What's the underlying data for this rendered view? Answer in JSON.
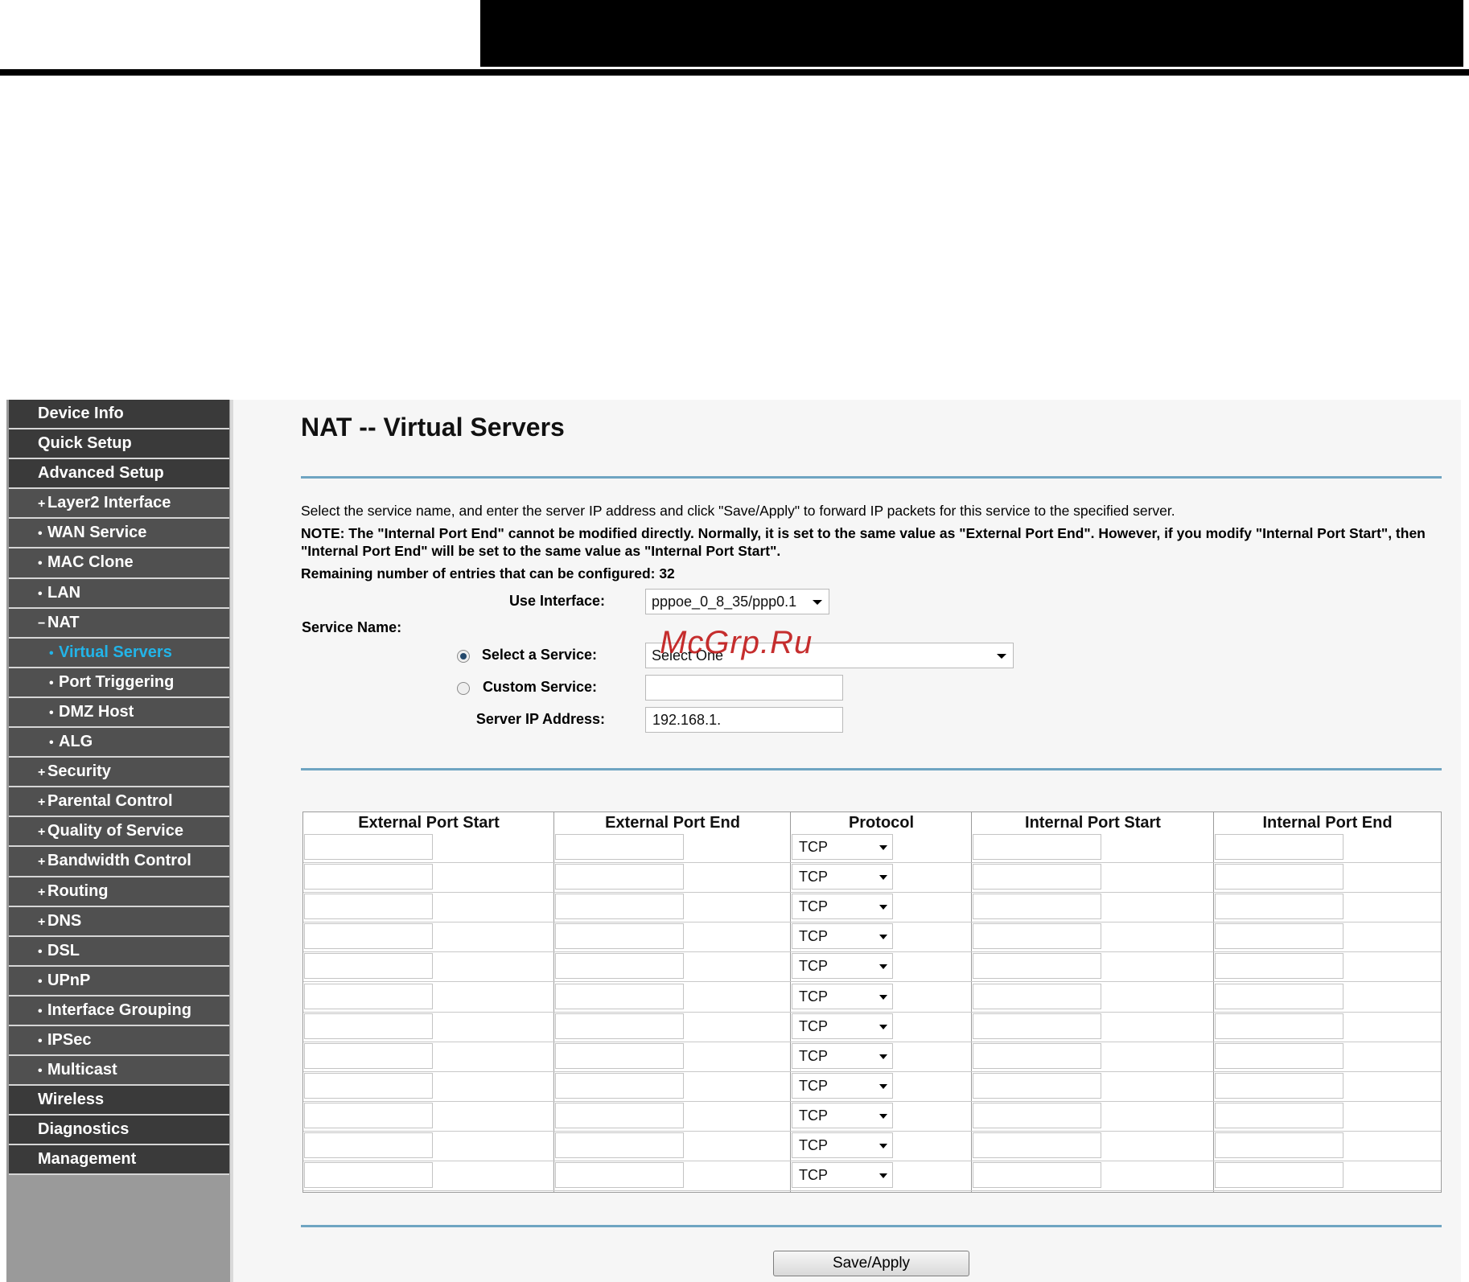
{
  "sidebar": {
    "items": [
      {
        "label": "Device Info",
        "level": "top",
        "marker": ""
      },
      {
        "label": "Quick Setup",
        "level": "top",
        "marker": ""
      },
      {
        "label": "Advanced Setup",
        "level": "top",
        "marker": ""
      },
      {
        "label": "Layer2 Interface",
        "level": "sub",
        "marker": "+"
      },
      {
        "label": "WAN Service",
        "level": "sub",
        "marker": "•"
      },
      {
        "label": "MAC Clone",
        "level": "sub",
        "marker": "•"
      },
      {
        "label": "LAN",
        "level": "sub",
        "marker": "•"
      },
      {
        "label": "NAT",
        "level": "sub",
        "marker": "−"
      },
      {
        "label": "Virtual Servers",
        "level": "subsub",
        "marker": "•",
        "active": true
      },
      {
        "label": "Port Triggering",
        "level": "subsub",
        "marker": "•"
      },
      {
        "label": "DMZ Host",
        "level": "subsub",
        "marker": "•"
      },
      {
        "label": "ALG",
        "level": "subsub",
        "marker": "•"
      },
      {
        "label": "Security",
        "level": "sub",
        "marker": "+"
      },
      {
        "label": "Parental Control",
        "level": "sub",
        "marker": "+"
      },
      {
        "label": "Quality of Service",
        "level": "sub",
        "marker": "+"
      },
      {
        "label": "Bandwidth Control",
        "level": "sub",
        "marker": "+"
      },
      {
        "label": "Routing",
        "level": "sub",
        "marker": "+"
      },
      {
        "label": "DNS",
        "level": "sub",
        "marker": "+"
      },
      {
        "label": "DSL",
        "level": "sub",
        "marker": "•"
      },
      {
        "label": "UPnP",
        "level": "sub",
        "marker": "•"
      },
      {
        "label": "Interface Grouping",
        "level": "sub",
        "marker": "•"
      },
      {
        "label": "IPSec",
        "level": "sub",
        "marker": "•"
      },
      {
        "label": "Multicast",
        "level": "sub",
        "marker": "•"
      },
      {
        "label": "Wireless",
        "level": "top",
        "marker": ""
      },
      {
        "label": "Diagnostics",
        "level": "top",
        "marker": ""
      },
      {
        "label": "Management",
        "level": "top",
        "marker": ""
      }
    ]
  },
  "main": {
    "title": "NAT -- Virtual Servers",
    "intro": "Select the service name, and enter the server IP address and click \"Save/Apply\" to forward IP packets for this service to the specified server.",
    "note_line1": "NOTE: The \"Internal Port End\" cannot be modified directly. Normally, it is set to the same value as \"External Port End\". However, if you modify \"Internal Port Start\", then",
    "note_line2": "\"Internal Port End\" will be set to the same value as \"Internal Port Start\".",
    "remaining": "Remaining number of entries that can be configured: 32"
  },
  "form": {
    "use_interface_label": "Use Interface:",
    "use_interface_value": "pppoe_0_8_35/ppp0.1",
    "service_name_label": "Service Name:",
    "select_service_label": "Select a Service:",
    "select_service_value": "Select One",
    "custom_service_label": "Custom Service:",
    "custom_service_value": "",
    "server_ip_label": "Server IP Address:",
    "server_ip_value": "192.168.1."
  },
  "ports_table": {
    "headers": [
      "External Port Start",
      "External Port End",
      "Protocol",
      "Internal Port Start",
      "Internal Port End"
    ],
    "rows": [
      {
        "protocol": "TCP"
      },
      {
        "protocol": "TCP"
      },
      {
        "protocol": "TCP"
      },
      {
        "protocol": "TCP"
      },
      {
        "protocol": "TCP"
      },
      {
        "protocol": "TCP"
      },
      {
        "protocol": "TCP"
      },
      {
        "protocol": "TCP"
      },
      {
        "protocol": "TCP"
      },
      {
        "protocol": "TCP"
      },
      {
        "protocol": "TCP"
      },
      {
        "protocol": "TCP"
      }
    ]
  },
  "actions": {
    "save_label": "Save/Apply"
  },
  "watermark": "McGrp.Ru",
  "colors": {
    "sidebar_dark": "#3a3a3a",
    "sidebar_sub": "#505050",
    "active_link": "#22b4e8",
    "divider": "#6fa5c2"
  }
}
